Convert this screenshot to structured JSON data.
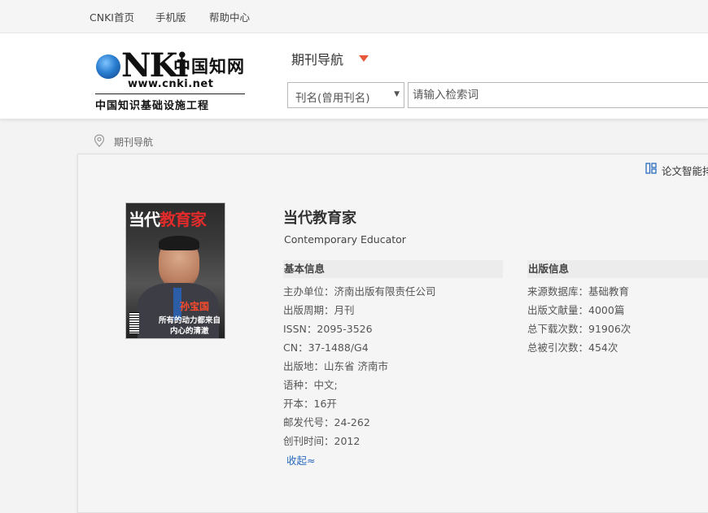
{
  "topnav": {
    "home": "CNKI首页",
    "mobile": "手机版",
    "help": "帮助中心"
  },
  "logo": {
    "brand": "CNKI",
    "cn_name": "中国知网",
    "url": "www.cnki.net",
    "subtitle": "中国知识基础设施工程"
  },
  "nav": {
    "title": "期刊导航"
  },
  "search": {
    "field_selected": "刊名(曾用刊名)",
    "placeholder": "请输入检索词"
  },
  "breadcrumb": {
    "label": "期刊导航"
  },
  "toolbar": {
    "smart_label": "论文智能排"
  },
  "cover": {
    "title_white": "当代",
    "title_red": "教育家",
    "person_name": "孙宝国",
    "line1": "所有的动力都来自",
    "line2": "内心的清澈"
  },
  "journal": {
    "title": "当代教育家",
    "english_title": "Contemporary Educator"
  },
  "basic_info": {
    "heading": "基本信息",
    "rows": [
      {
        "label": "主办单位：",
        "value": "济南出版有限责任公司"
      },
      {
        "label": "出版周期：",
        "value": "月刊"
      },
      {
        "label": "ISSN：",
        "value": "2095-3526"
      },
      {
        "label": "CN：",
        "value": "37-1488/G4"
      },
      {
        "label": "出版地：",
        "value": "山东省 济南市"
      },
      {
        "label": "语种：",
        "value": "中文;"
      },
      {
        "label": "开本：",
        "value": "16开"
      },
      {
        "label": "邮发代号：",
        "value": "24-262"
      },
      {
        "label": "创刊时间：",
        "value": "2012"
      }
    ],
    "collapse_label": "收起≈"
  },
  "publish_info": {
    "heading": "出版信息",
    "rows": [
      {
        "label": "来源数据库：",
        "value": "基础教育"
      },
      {
        "label": "出版文献量：",
        "value": "4000篇"
      },
      {
        "label": "总下载次数：",
        "value": "91906次"
      },
      {
        "label": "总被引次数：",
        "value": "454次"
      }
    ]
  },
  "colors": {
    "accent_arrow": "#e8593c",
    "link": "#2a6bc0",
    "cover_red": "#e32b2b"
  }
}
